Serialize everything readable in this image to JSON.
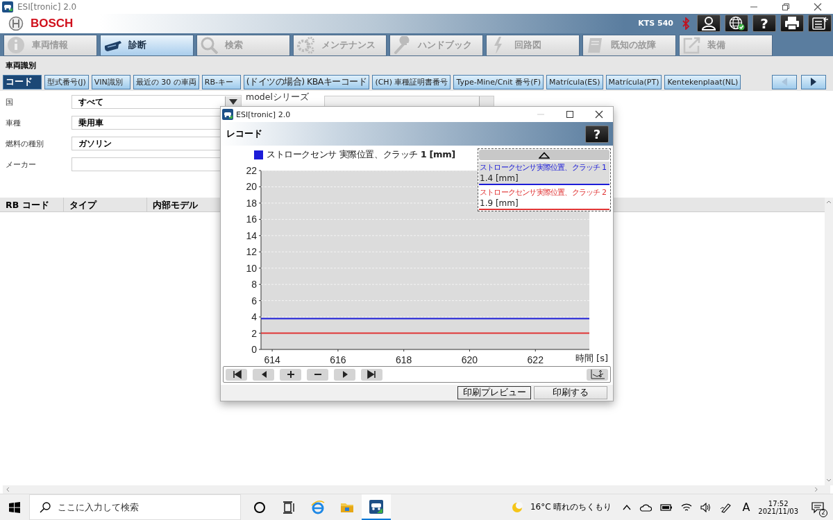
{
  "app_window": {
    "title": "ESI[tronic] 2.0"
  },
  "header": {
    "brand": "BOSCH",
    "device": "KTS 540",
    "help_label": "?"
  },
  "main_tabs": [
    {
      "label": "車両情報",
      "selected": false
    },
    {
      "label": "診断",
      "selected": true
    },
    {
      "label": "検索",
      "selected": false
    },
    {
      "label": "メンテナンス",
      "selected": false
    },
    {
      "label": "ハンドブック",
      "selected": false
    },
    {
      "label": "回路図",
      "selected": false
    },
    {
      "label": "既知の故障",
      "selected": false
    },
    {
      "label": "装備",
      "selected": false
    }
  ],
  "section_title": "車両識別",
  "sub_tabs": [
    {
      "label": "コード",
      "selected": true
    },
    {
      "label": "型式番号(J)",
      "selected": false
    },
    {
      "label": "VIN識別",
      "selected": false
    },
    {
      "label": "最近の 30 の車両",
      "selected": false
    },
    {
      "label": "RB-キー",
      "selected": false
    },
    {
      "label": "(ドイツの場合) KBAキーコード",
      "selected": false
    },
    {
      "label": "(CH) 車種証明書番号",
      "selected": false
    },
    {
      "label": "Type-Mine/Cnit 番号(F)",
      "selected": false
    },
    {
      "label": "Matrícula(ES)",
      "selected": false
    },
    {
      "label": "Matrícula(PT)",
      "selected": false
    },
    {
      "label": "Kentekenplaat(NL)",
      "selected": false
    }
  ],
  "pager_buttons": [
    {
      "kind": "prev",
      "disabled": true
    },
    {
      "kind": "next",
      "disabled": false
    }
  ],
  "form": [
    {
      "label": "国",
      "value": "すべて",
      "kind": "dropdown"
    },
    {
      "label": "車種",
      "value": "乗用車",
      "kind": "text"
    },
    {
      "label": "燃料の種別",
      "value": "ガソリン",
      "kind": "text"
    },
    {
      "label": "メーカー",
      "kind": "text"
    }
  ],
  "model_series": {
    "label": "modelシリーズ"
  },
  "table": {
    "columns": [
      "RB コード",
      "タイプ",
      "内部モデル"
    ]
  },
  "dialog": {
    "title": "ESI[tronic] 2.0",
    "heading": "レコード",
    "help_label": "?",
    "legend_title": "ストロークセンサ 実際位置、クラッチ **1 [mm]**",
    "readings": [
      "1.4 [mm]",
      "1.9 [mm]"
    ],
    "chart_data": {
      "type": "line",
      "grid": true,
      "xlabel": "時間 [s]",
      "xlim": [
        613.66,
        623.64
      ],
      "ylim": [
        0,
        22
      ],
      "xticks": [
        614,
        616,
        618,
        620,
        622
      ],
      "yticks": [
        0,
        2,
        4,
        6,
        8,
        10,
        12,
        14,
        16,
        18,
        20,
        22
      ],
      "x": [
        613.66,
        623.64
      ],
      "series": [
        {
          "name": "ストロークセンサ実際位置、クラッチ 1",
          "color": "#1c1cd8",
          "values": [
            3.8,
            3.8
          ]
        },
        {
          "name": "ストロークセンサ実際位置、クラッチ 2",
          "color": "#e03434",
          "values": [
            2,
            2
          ]
        }
      ]
    },
    "buttons": [
      "印刷プレビュー",
      "印刷する"
    ]
  },
  "taskbar": {
    "search_placeholder": "ここに入力して検索",
    "weather": "16°C 晴れのちくもり",
    "ime": "A",
    "time": "17:52",
    "date": "2021/11/03",
    "notifications": "2"
  }
}
